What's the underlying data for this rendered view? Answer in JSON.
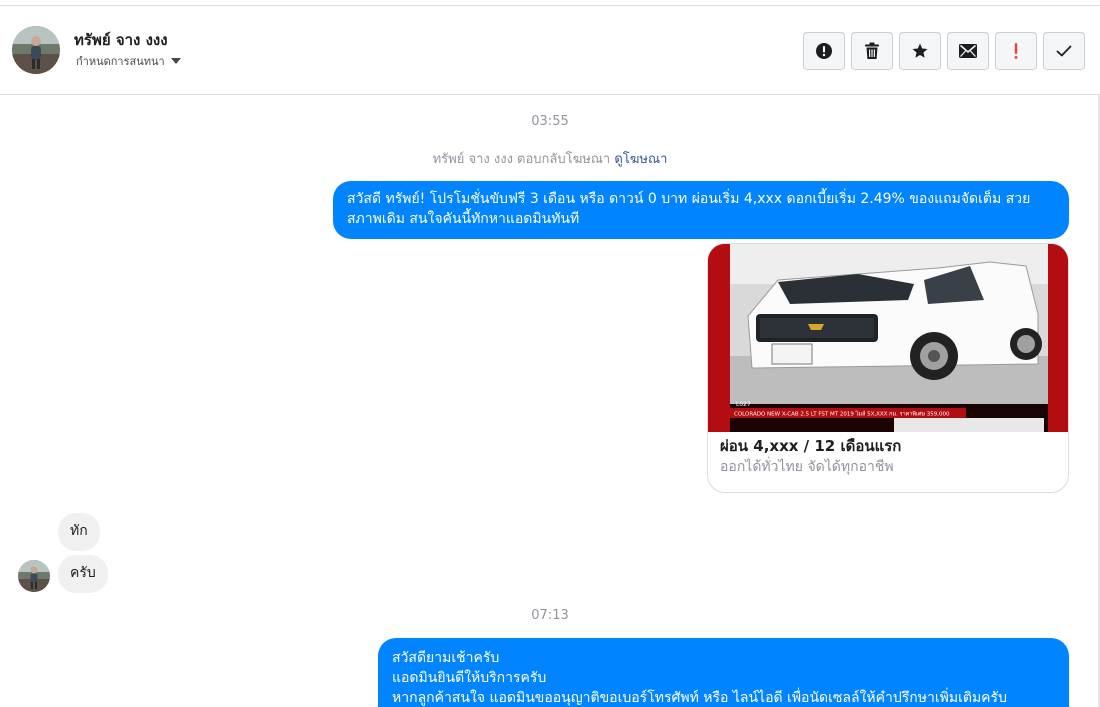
{
  "header": {
    "contact_name": "ทรัพย์ จาง งงง",
    "assign_label": "กำหนดการสนทนา"
  },
  "toolbar": {
    "buttons": [
      {
        "name": "spam-button",
        "icon": "alert-circle-icon"
      },
      {
        "name": "delete-button",
        "icon": "trash-icon"
      },
      {
        "name": "star-button",
        "icon": "star-icon"
      },
      {
        "name": "mark-unread-button",
        "icon": "envelope-icon"
      },
      {
        "name": "follow-up-button",
        "icon": "exclamation-icon"
      },
      {
        "name": "mark-done-button",
        "icon": "checkmark-icon"
      }
    ],
    "accent_red": "#fa3e3e"
  },
  "conversation": {
    "timestamp_1": "03:55",
    "ad_reply_text": "ทรัพย์ จาง งงง ตอบกลับโฆษณา",
    "ad_reply_link": "ดูโฆษณา",
    "message_out_1": "สวัสดี ทรัพย์! โปรโมชั่นขับฟรี 3 เดือน หรือ ดาวน์ 0 บาท ผ่อนเริ่ม 4,xxx ดอกเบี้ยเริ่ม 2.49% ของแถมจัดเต็ม สวยสภาพเดิม สนใจคันนี้ทักหาแอดมินทันที",
    "ad_card": {
      "title": "ผ่อน 4,xxx / 12 เดือนแรก",
      "subtitle": "ออกได้ทั่วไทย จัดได้ทุกอาชีพ",
      "image_caption": "COLORADO NEW X-CAB 2.5 LT FST MT 2019 ไมล์ 5X,XXX กม. ราคาพิเศษ 359,000",
      "image_code": "L027"
    },
    "message_in_1": "ทัก",
    "message_in_2": "ครับ",
    "timestamp_2": "07:13",
    "message_out_2_lines": [
      "สวัสดียามเช้าครับ",
      "แอดมินยินดีให้บริการครับ",
      "หากลูกค้าสนใจ แอดมินขออนุญาติขอเบอร์โทรศัพท์ หรือ ไลน์ไอดี เพื่อนัดเซลล์ให้คำปรึกษาเพิ่มเติมครับ"
    ]
  },
  "colors": {
    "outgoing_bubble": "#0084ff",
    "incoming_bubble": "#f1f0f0",
    "link": "#385898"
  }
}
